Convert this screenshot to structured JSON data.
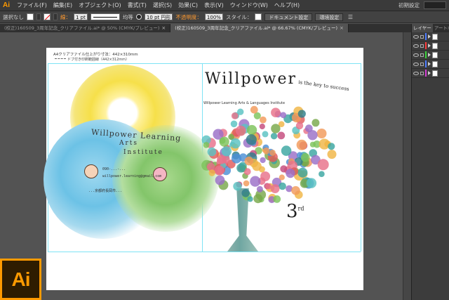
{
  "app": {
    "logo_small": "Ai",
    "logo_big": "Ai",
    "workspace": "初期設定"
  },
  "menu": {
    "items": [
      "ファイル(F)",
      "編集(E)",
      "オブジェクト(O)",
      "書式(T)",
      "選択(S)",
      "効果(C)",
      "表示(V)",
      "ウィンドウ(W)",
      "ヘルプ(H)"
    ]
  },
  "control": {
    "selection": "選択なし",
    "stroke_label": "線：",
    "stroke_value": "1 pt",
    "stroke_style": "均等",
    "brush": "10 pt 円形",
    "opacity_label": "不透明度：",
    "opacity_value": "100%",
    "style_label": "スタイル：",
    "doc_setup": "ドキュメント設定",
    "prefs": "環境設定"
  },
  "tabs": [
    {
      "label": "(校正)160509_3周年記念_クリアファイル.ai* @ 50% (CMYK/プレビュー)",
      "active": false
    },
    {
      "label": "(校正)160509_3周年記念_クリアファイル.ai* @ 66.67% (CMYK/プレビュー)",
      "active": true
    }
  ],
  "panel": {
    "tabs": [
      "レイヤー",
      "アートボード"
    ],
    "layers": [
      {
        "color": "#4b7bff"
      },
      {
        "color": "#ff3b3b"
      },
      {
        "color": "#3bd23b"
      },
      {
        "color": "#4b7bff"
      },
      {
        "color": "#d23bd2"
      }
    ]
  },
  "artboard": {
    "bleed_note_1": "A4クリアファイル仕上がり寸法：442×310mm",
    "bleed_note_2": "ドブ付き印刷範囲線（442×312mm）",
    "left": {
      "title": "Willpower Learning",
      "sub1": "Arts",
      "sub2": "Institute",
      "phone": "090-...-...",
      "email": "willpower.learning@gmail.com",
      "address": "...京都府長岡市..."
    },
    "right": {
      "title": "Willpower",
      "tagline": "is the key to success",
      "subtitle": "Willpower Learning Arts & Languages Institute",
      "anniversary": "3",
      "anniversary_sup": "rd"
    }
  }
}
